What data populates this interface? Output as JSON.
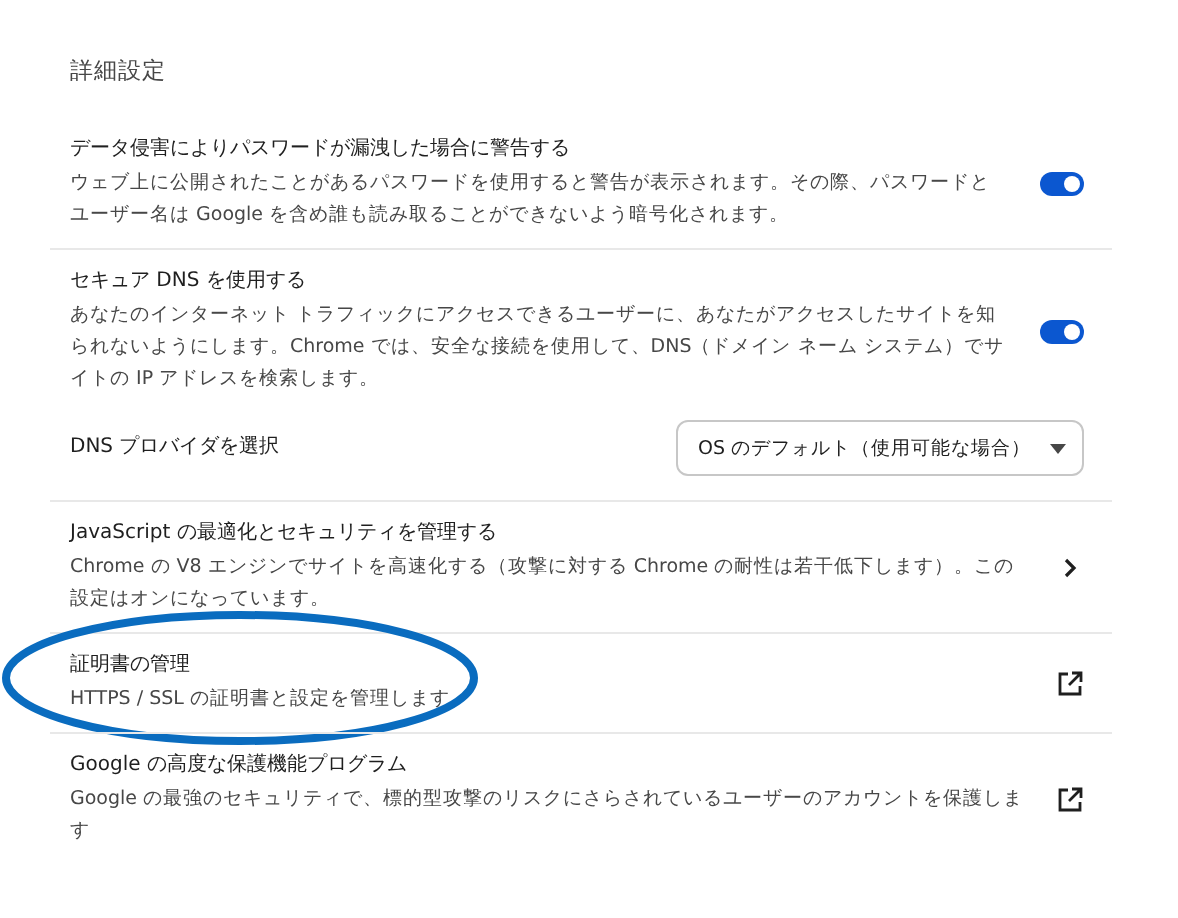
{
  "section_title": "詳細設定",
  "rows": [
    {
      "kind": "toggle",
      "title": "データ侵害によりパスワードが漏洩した場合に警告する",
      "description": "ウェブ上に公開されたことがあるパスワードを使用すると警告が表示されます。その際、パスワードとユーザー名は Google を含め誰も読み取ることができないよう暗号化されます。",
      "on": true,
      "circled": false
    },
    {
      "kind": "toggle",
      "title": "セキュア DNS を使用する",
      "description": "あなたのインターネット トラフィックにアクセスできるユーザーに、あなたがアクセスしたサイトを知られないようにします。Chrome では、安全な接続を使用して、DNS（ドメイン ネーム システム）でサイトの IP アドレスを検索します。",
      "on": true,
      "circled": false
    },
    {
      "kind": "select",
      "title": "DNS プロバイダを選択",
      "value": "OS のデフォルト（使用可能な場合）",
      "circled": false
    },
    {
      "kind": "subpage",
      "title": "JavaScript の最適化とセキュリティを管理する",
      "description": "Chrome の V8 エンジンでサイトを高速化する（攻撃に対する Chrome の耐性は若干低下します）。この設定はオンになっています。",
      "circled": false
    },
    {
      "kind": "external",
      "title": "証明書の管理",
      "description": "HTTPS / SSL の証明書と設定を管理します",
      "circled": true
    },
    {
      "kind": "external",
      "title": "Google の高度な保護機能プログラム",
      "description": "Google の最強のセキュリティで、標的型攻撃のリスクにさらされているユーザーのアカウントを保護します",
      "circled": false
    }
  ]
}
